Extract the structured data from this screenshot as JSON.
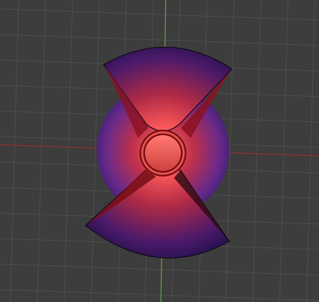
{
  "viewport": {
    "background_color": "#3d3d3d",
    "grid_line_color": "#4f4f4f",
    "x_axis_color": "#9a2f33",
    "y_axis_color": "#5fae3c"
  },
  "object": {
    "icon": "disc-mesh-icon",
    "center_color": "#ff6a6a",
    "mid_color": "#c02838",
    "edge_color": "#1a0a4a",
    "hub_rim_color": "#7a0e14"
  }
}
